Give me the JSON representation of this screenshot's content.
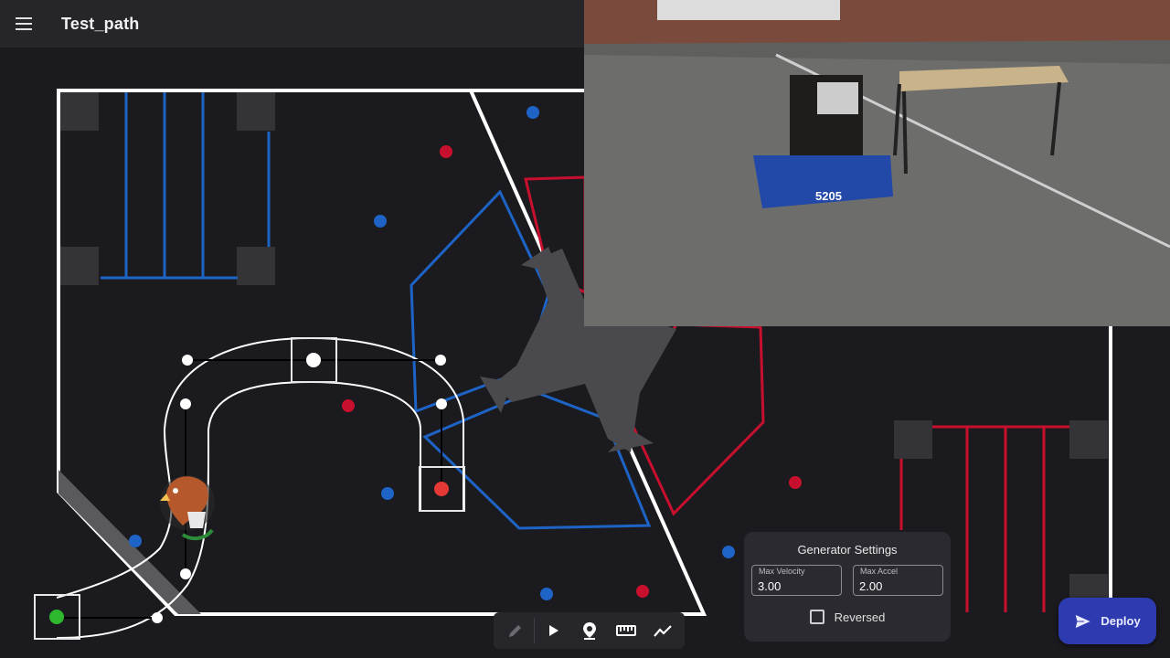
{
  "app": {
    "title": "Test_path"
  },
  "toolbar": {
    "tools": [
      "pencil-icon",
      "play-icon",
      "location-pin-icon",
      "ruler-icon",
      "graph-icon"
    ]
  },
  "generator_settings": {
    "title": "Generator Settings",
    "max_velocity_label": "Max Velocity",
    "max_velocity_value": "3.00",
    "max_accel_label": "Max Accel",
    "max_accel_value": "2.00",
    "reversed_label": "Reversed",
    "reversed_checked": false
  },
  "deploy": {
    "label": "Deploy"
  },
  "camera": {
    "robot_number": "5205"
  },
  "colors": {
    "background": "#1b1b1f",
    "field_line": "#ffffff",
    "blue_alliance": "#1e63c6",
    "red_alliance": "#c8102e",
    "waypoint_start": "#2eb82e",
    "waypoint_end": "#e53935",
    "deploy_button": "#2e3bb0"
  }
}
